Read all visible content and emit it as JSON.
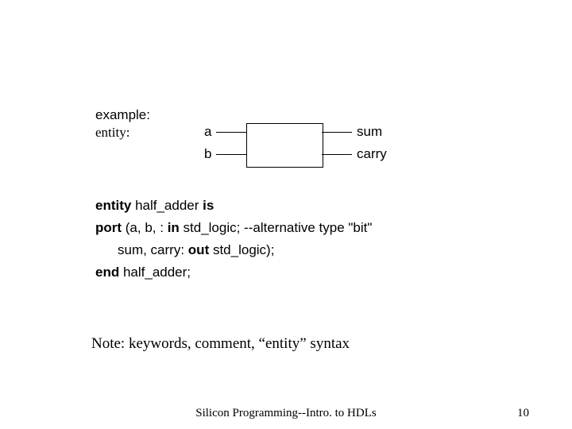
{
  "example_label": "example:",
  "entity_label": "entity:",
  "diagram": {
    "input_a": "a",
    "input_b": "b",
    "output_sum": "sum",
    "output_carry": "carry"
  },
  "code": {
    "l1_kw1": "entity",
    "l1_name": " half_adder ",
    "l1_kw2": "is",
    "l2_kw1": "port",
    "l2_rest1": " (a, b, : ",
    "l2_kw2": "in",
    "l2_rest2": " std_logic;  --alternative type \"bit\"",
    "l3_rest1": "sum, carry: ",
    "l3_kw1": "out",
    "l3_rest2": " std_logic);",
    "l4_kw1": "end",
    "l4_rest": " half_adder;"
  },
  "note": "Note:  keywords, comment, “entity” syntax",
  "footer_title": "Silicon Programming--Intro. to HDLs",
  "footer_page": "10"
}
